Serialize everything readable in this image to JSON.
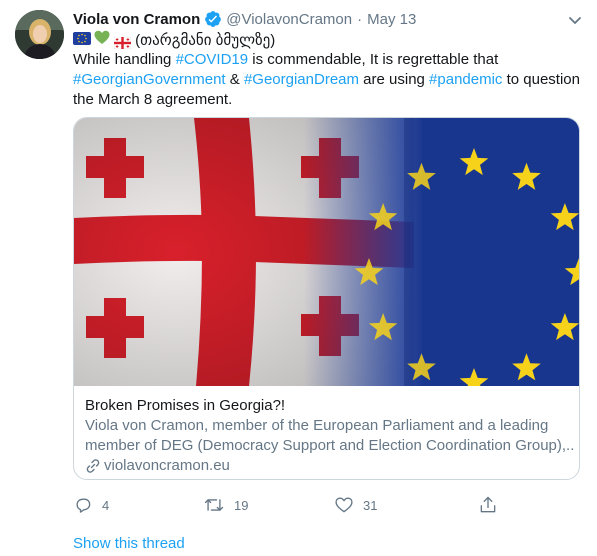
{
  "tweet": {
    "author_name": "Viola von Cramon",
    "handle": "@ViolavonCramon",
    "separator": "·",
    "date": "May 13",
    "line2_suffix": " (თარგმანი ბმულზე)",
    "text_lines": [
      [
        {
          "t": "While handling ",
          "tag": false
        },
        {
          "t": "#COVID19",
          "tag": true
        },
        {
          "t": " is commendable, It is regrettable that",
          "tag": false
        }
      ],
      [
        {
          "t": "#GeorgianGovernment",
          "tag": true
        },
        {
          "t": " & ",
          "tag": false
        },
        {
          "t": "#GeorgianDream",
          "tag": true
        },
        {
          "t": " are using ",
          "tag": false
        },
        {
          "t": "#pandemic",
          "tag": true
        },
        {
          "t": " to question",
          "tag": false
        }
      ],
      [
        {
          "t": "the March 8 agreement.",
          "tag": false
        }
      ]
    ]
  },
  "card": {
    "title": "Broken Promises in Georgia?!",
    "description_line1": "Viola von Cramon, member of the European Parliament and a leading",
    "description_line2": "member of DEG (Democracy Support and Election Coordination Group),...",
    "link": "violavoncramon.eu"
  },
  "actions": {
    "reply_count": "4",
    "retweet_count": "19",
    "like_count": "31"
  },
  "show_thread_label": "Show this thread",
  "colors": {
    "accent": "#1da1f2",
    "muted": "#657786",
    "text": "#14171a",
    "border": "#ccd6dd",
    "eu_blue": "#1f3fa0",
    "eu_star": "#f7d21b",
    "georgia_red": "#d8202b"
  }
}
